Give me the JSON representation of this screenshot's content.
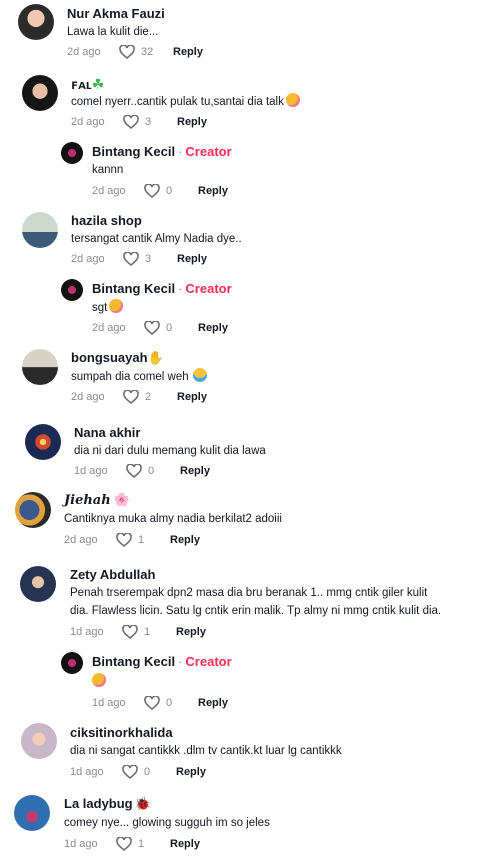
{
  "comments": [
    {
      "name": "Nur Akma Fauzi",
      "text": "Lawa la kulit die...",
      "time": "2d ago",
      "likes": "32",
      "reply": "Reply"
    },
    {
      "name": "ꜰᴀʟ",
      "name_emoji": "☘",
      "text": "comel nyerr..cantik pulak tu,santai dia talk",
      "time": "2d ago",
      "likes": "3",
      "reply": "Reply"
    },
    {
      "name": "Bintang Kecil",
      "badge": "Creator",
      "text": "kannn",
      "time": "2d ago",
      "likes": "0",
      "reply": "Reply"
    },
    {
      "name": "hazila shop",
      "text": "tersangat cantik Almy Nadia dye..",
      "time": "2d ago",
      "likes": "3",
      "reply": "Reply"
    },
    {
      "name": "Bintang Kecil",
      "badge": "Creator",
      "text": "sgt",
      "time": "2d ago",
      "likes": "0",
      "reply": "Reply"
    },
    {
      "name": "bongsuayah",
      "name_emoji": "✋",
      "text": "sumpah dia comel weh",
      "time": "2d ago",
      "likes": "2",
      "reply": "Reply"
    },
    {
      "name": "Nana akhir",
      "text": "dia ni dari dulu memang kulit dia lawa",
      "time": "1d ago",
      "likes": "0",
      "reply": "Reply"
    },
    {
      "name": "𝑱𝒊𝒆𝒉𝒂𝒉",
      "name_emoji": "🌸",
      "text": "Cantiknya muka almy nadia berkilat2 adoiii",
      "time": "2d ago",
      "likes": "1",
      "reply": "Reply"
    },
    {
      "name": "Zety Abdullah",
      "text_line1": "Penah trserempak dpn2 masa dia bru beranak 1.. mmg cntik giler kulit",
      "text_line2": "dia. Flawless licin. Satu lg cntik erin malik. Tp almy ni mmg cntik kulit dia.",
      "time": "1d ago",
      "likes": "1",
      "reply": "Reply"
    },
    {
      "name": "Bintang Kecil",
      "badge": "Creator",
      "text": "",
      "time": "1d ago",
      "likes": "0",
      "reply": "Reply"
    },
    {
      "name": "ciksitinorkhalida",
      "text": "dia ni sangat cantikkk .dlm tv cantik.kt luar lg cantikkk",
      "time": "1d ago",
      "likes": "0",
      "reply": "Reply"
    },
    {
      "name": "La ladybug",
      "name_emoji": "🐞",
      "text": "comey nye... glowing sugguh im so jeles",
      "time": "1d ago",
      "likes": "1",
      "reply": "Reply"
    }
  ],
  "separator": "·"
}
